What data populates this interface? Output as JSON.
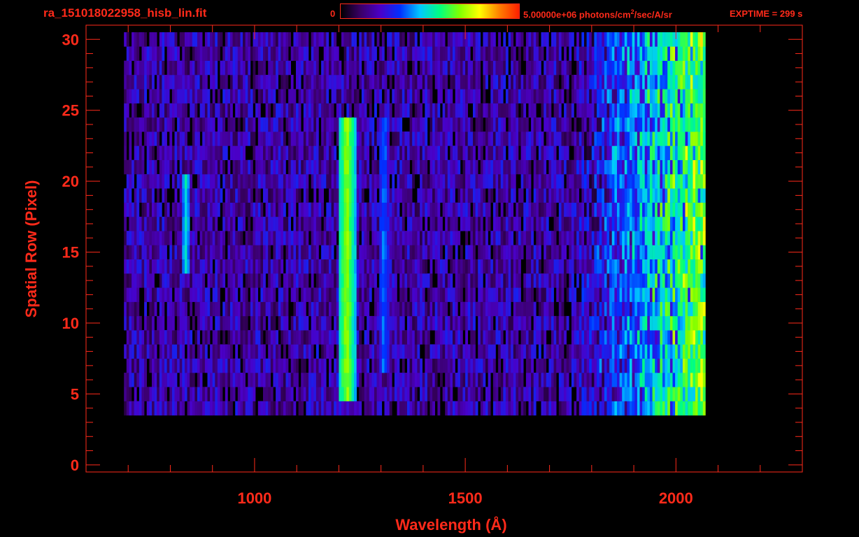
{
  "header": {
    "filename": "ra_151018022958_hisb_lin.fit",
    "colorbar_min": "0",
    "colorbar_max_value": "5.00000e+06 photons/cm",
    "colorbar_max_exp": "2",
    "colorbar_max_unit": "/sec/A/sr",
    "exptime": "EXPTIME = 299 s"
  },
  "colors": {
    "axis": "#ff2a1a",
    "background": "#000000",
    "colormap": [
      "#000000",
      "#3a0066",
      "#4a00c8",
      "#0030ff",
      "#00c8ff",
      "#00ff80",
      "#80ff00",
      "#ffff00",
      "#ff8000",
      "#ff2000"
    ]
  },
  "chart_data": {
    "type": "heatmap",
    "title": "ra_151018022958_hisb_lin.fit",
    "xlabel": "Wavelength (Å)",
    "ylabel": "Spatial Row (Pixel)",
    "xlim": [
      600,
      2300
    ],
    "ylim": [
      -0.5,
      31
    ],
    "xticks": [
      1000,
      1500,
      2000
    ],
    "yticks": [
      0,
      5,
      10,
      15,
      20,
      25,
      30
    ],
    "color_scale": {
      "min": 0,
      "max": 5000000,
      "unit": "photons/cm^2/sec/A/sr"
    },
    "data_extent": {
      "x": [
        690,
        2065
      ],
      "y": [
        4,
        30
      ]
    },
    "features": [
      {
        "name": "emission-line-834",
        "x": 834,
        "rows": [
          14,
          20
        ],
        "level": 0.45
      },
      {
        "name": "emission-line-1216",
        "x": 1216,
        "rows": [
          5,
          24
        ],
        "level": 0.65
      },
      {
        "name": "emission-line-1304",
        "x": 1304,
        "rows": [
          7,
          24
        ],
        "level": 0.35
      },
      {
        "name": "continuum-rise",
        "x": [
          1750,
          2065
        ],
        "rows": [
          4,
          30
        ],
        "level": 0.5
      }
    ],
    "grid": false
  }
}
